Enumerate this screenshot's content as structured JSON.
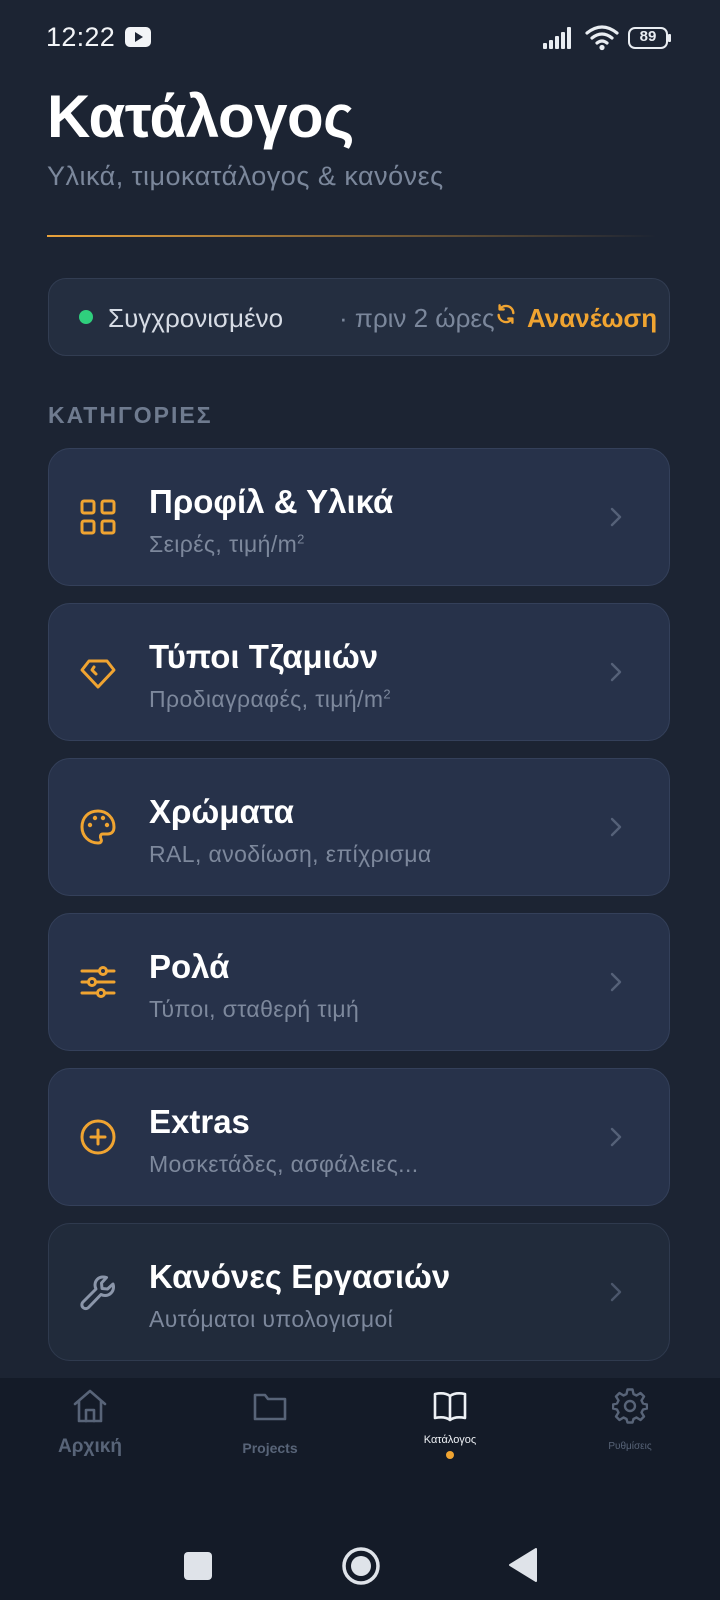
{
  "status_bar": {
    "time": "12:22",
    "battery": "89"
  },
  "header": {
    "title": "Κατάλογος",
    "subtitle": "Υλικά, τιμοκατάλογος & κανόνες"
  },
  "sync": {
    "status": "Συγχρονισμένο",
    "time": "· πριν 2 ώρες",
    "refresh_label": "Ανανέωση",
    "status_color": "#2fcf7d"
  },
  "categories_heading": "ΚΑΤΗΓΟΡΙΕΣ",
  "categories": [
    {
      "title": "Προφίλ & Υλικά",
      "desc": "Σειρές, τιμή/m",
      "desc_sup": "2",
      "icon": "grid-icon"
    },
    {
      "title": "Τύποι Τζαμιών",
      "desc": "Προδιαγραφές, τιμή/m",
      "desc_sup": "2",
      "icon": "diamond-icon"
    },
    {
      "title": "Χρώματα",
      "desc": "RAL, ανοδίωση, επίχρισμα",
      "icon": "palette-icon"
    },
    {
      "title": "Ρολά",
      "desc": "Τύποι, σταθερή τιμή",
      "icon": "sliders-icon"
    },
    {
      "title": "Extras",
      "desc": "Μοσκετάδες, ασφάλειες...",
      "icon": "plus-circle-icon"
    },
    {
      "title": "Κανόνες Εργασιών",
      "desc": "Αυτόματοι υπολογισμοί",
      "icon": "wrench-icon"
    }
  ],
  "bottom_nav": [
    {
      "label": "Αρχική",
      "icon": "home-icon"
    },
    {
      "label": "Projects",
      "icon": "folder-icon"
    },
    {
      "label": "Κατάλογος",
      "icon": "book-icon",
      "active": true
    },
    {
      "label": "Ρυθμίσεις",
      "icon": "gear-icon"
    }
  ],
  "colors": {
    "accent": "#f0a431",
    "background": "#1c2433",
    "card": "#27324a"
  }
}
